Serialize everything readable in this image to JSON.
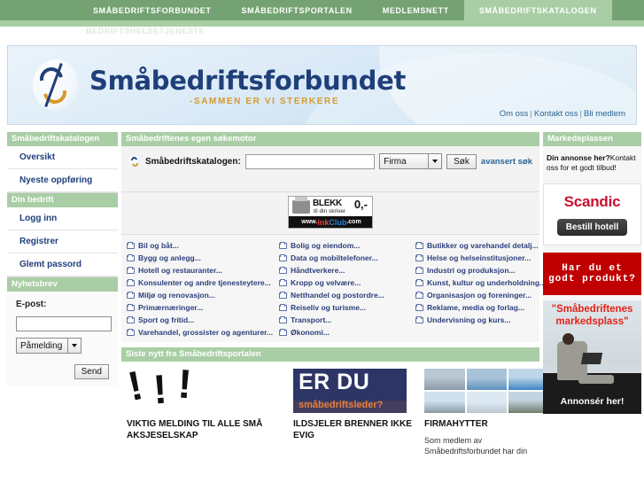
{
  "topnav": {
    "tabs": [
      {
        "label": "SMÅBEDRIFTSFORBUNDET",
        "active": false
      },
      {
        "label": "SMÅBEDRIFTSPORTALEN",
        "active": false
      },
      {
        "label": "MEDLEMSNETT",
        "active": false
      },
      {
        "label": "SMÅBEDRIFTSKATALOGEN",
        "active": true
      }
    ],
    "subtab": "BEDRIFTSHELSETJENESTE"
  },
  "banner": {
    "logo_text": "Småbedriftsforbundet",
    "tagline": "-SAMMEN ER VI STERKERE",
    "links": [
      "Om oss",
      "Kontakt oss",
      "Bli medlem"
    ],
    "separator": "|"
  },
  "sidebar": {
    "section1_title": "Småbedriftskatalogen",
    "section1_items": [
      {
        "label": "Oversikt"
      },
      {
        "label": "Nyeste oppføring"
      }
    ],
    "section2_title": "Din bedrift",
    "section2_items": [
      {
        "label": "Logg inn"
      },
      {
        "label": "Registrer"
      },
      {
        "label": "Glemt passord"
      }
    ],
    "newsletter_title": "Nyhetsbrev",
    "newsletter_label": "E-post:",
    "newsletter_value": "",
    "newsletter_placeholder": "",
    "newsletter_select": "Påmelding",
    "newsletter_submit": "Send"
  },
  "search": {
    "panel_title": "Småbedriftenes egen søkemotor",
    "label": "Småbedriftskatalogen:",
    "value": "",
    "placeholder": "",
    "scope_select": "Firma",
    "submit": "Søk",
    "advanced_link": "avansert søk"
  },
  "ad_banner": {
    "headline": "BLEKK",
    "price": "0,-",
    "subtitle": "til din skriver",
    "www": "www.",
    "ink": "ink",
    "club": "Club",
    "com": ".com"
  },
  "categories": {
    "column1": [
      "Bil og båt...",
      "Bygg og anlegg...",
      "Hotell og restauranter...",
      "Konsulenter og andre tjenesteytere...",
      "Miljø og renovasjon...",
      "Primærnæringer...",
      "Sport og fritid...",
      "Varehandel, grossister og agenturer..."
    ],
    "column2": [
      "Bolig og eiendom...",
      "Data og mobiltelefoner...",
      "Håndtverkere...",
      "Kropp og velvære...",
      "Netthandel og postordre...",
      "Reiseliv og turisme...",
      "Transport...",
      "Økonomi..."
    ],
    "column3": [
      "Butikker og varehandel detalj...",
      "Helse og helseinstitusjoner...",
      "Industri og produksjon...",
      "Kunst, kultur og underholdning...",
      "Organisasjon og foreninger...",
      "Reklame, media og forlag...",
      "Undervisning og kurs..."
    ]
  },
  "news": {
    "panel_title": "Siste nytt fra Småbedriftsportalen",
    "items": [
      {
        "title": "VIKTIG MELDING TIL ALLE SMÅ AKSJESELSKAP",
        "body": ""
      },
      {
        "title": "ILDSJELER BRENNER IKKE EVIG",
        "body": "",
        "image_big": "ER DU",
        "image_sub": "småbedriftsleder?"
      },
      {
        "title": "FIRMAHYTTER",
        "body": "Som medlem av Småbedriftsforbundet har din"
      }
    ]
  },
  "marketplace": {
    "panel_title": "Markedsplassen",
    "ad_lead": "Din annonse her?",
    "ad_rest": "Kontakt oss for et godt tilbud!",
    "scandic_brand": "Scandic",
    "scandic_button": "Bestill hotell",
    "red_line1": "Har du et",
    "red_line2": "godt produkt?",
    "market_line1": "\"Småbedriftenes",
    "market_line2": "markedsplass\"",
    "market_cta": "Annonsér her!"
  },
  "colors": {
    "nav_green": "#74a272",
    "nav_green_light": "#a9cea5",
    "link_blue": "#2a6496",
    "logo_blue": "#1f3f7a",
    "logo_gold": "#d79a2b",
    "red_ad": "#c00000",
    "scandic_red": "#c8102e"
  }
}
